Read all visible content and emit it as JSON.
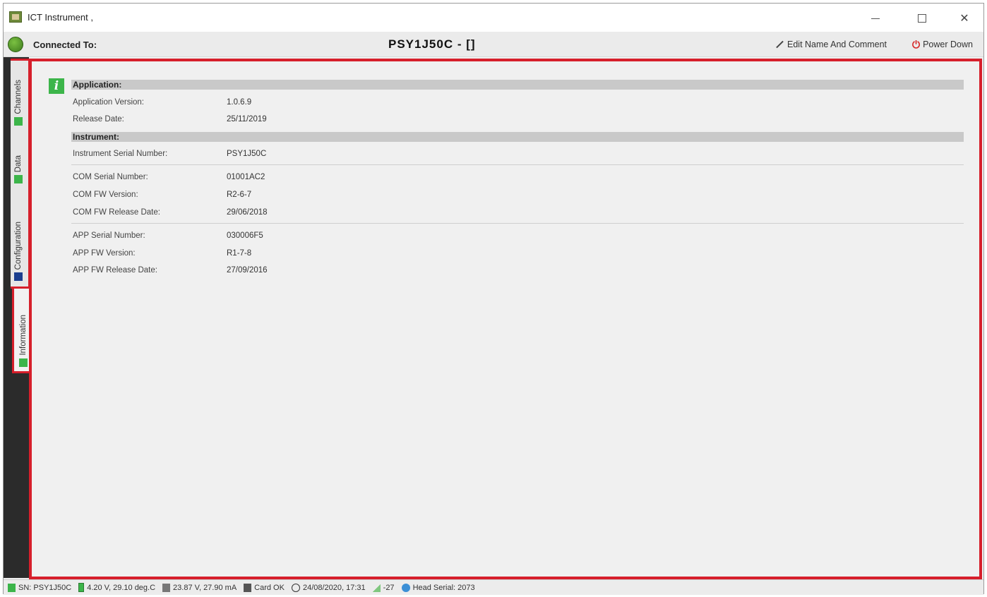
{
  "window": {
    "title": "ICT Instrument ,"
  },
  "header": {
    "connected_label": "Connected To:",
    "device_title": "PSY1J50C - []",
    "edit_label": "Edit Name And Comment",
    "power_label": "Power Down"
  },
  "tabs": [
    {
      "label": "Channels",
      "icon": "channels-icon",
      "active": false
    },
    {
      "label": "Data",
      "icon": "data-icon",
      "active": false
    },
    {
      "label": "Configuration",
      "icon": "configuration-icon",
      "active": false
    },
    {
      "label": "Information",
      "icon": "information-icon",
      "active": true
    }
  ],
  "info": {
    "application_header": "Application:",
    "app_version_label": "Application Version:",
    "app_version_value": "1.0.6.9",
    "release_date_label": "Release Date:",
    "release_date_value": "25/11/2019",
    "instrument_header": "Instrument:",
    "inst_serial_label": "Instrument Serial Number:",
    "inst_serial_value": "PSY1J50C",
    "com_serial_label": "COM Serial Number:",
    "com_serial_value": "01001AC2",
    "com_fw_label": "COM FW Version:",
    "com_fw_value": "R2-6-7",
    "com_fw_date_label": "COM FW Release Date:",
    "com_fw_date_value": "29/06/2018",
    "app_serial_label": "APP Serial Number:",
    "app_serial_value": "030006F5",
    "app_fw_label": "APP FW Version:",
    "app_fw_value": "R1-7-8",
    "app_fw_date_label": "APP FW Release Date:",
    "app_fw_date_value": "27/09/2016"
  },
  "status": {
    "serial": "SN: PSY1J50C",
    "battery": "4.20 V, 29.10 deg.C",
    "power": "23.87 V, 27.90 mA",
    "card": "Card OK",
    "datetime": "24/08/2020, 17:31",
    "signal": "-27",
    "head_serial": "Head Serial: 2073"
  },
  "colors": {
    "highlight_border": "#d61f2b",
    "accent_green": "#3cb54a",
    "section_header_bg": "#c9c9c9"
  }
}
